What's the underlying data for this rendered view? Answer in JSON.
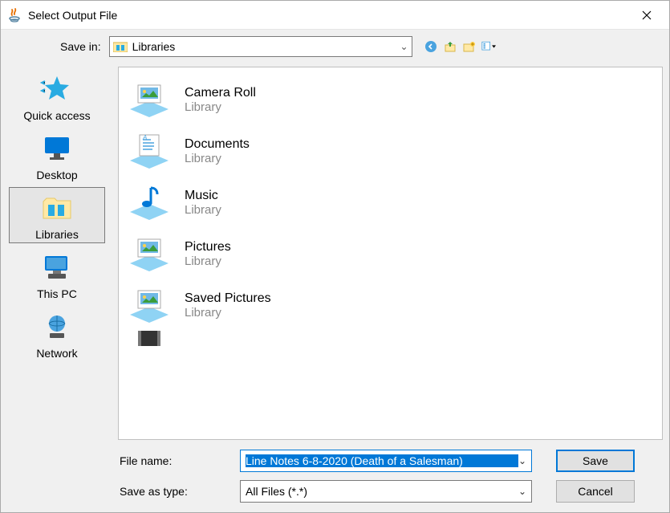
{
  "window": {
    "title": "Select Output File"
  },
  "toolbar": {
    "save_in_label": "Save in:",
    "location": "Libraries"
  },
  "sidebar": {
    "items": [
      {
        "label": "Quick access"
      },
      {
        "label": "Desktop"
      },
      {
        "label": "Libraries"
      },
      {
        "label": "This PC"
      },
      {
        "label": "Network"
      }
    ]
  },
  "files": [
    {
      "name": "Camera Roll",
      "subtitle": "Library",
      "icon": "image"
    },
    {
      "name": "Documents",
      "subtitle": "Library",
      "icon": "doc"
    },
    {
      "name": "Music",
      "subtitle": "Library",
      "icon": "music"
    },
    {
      "name": "Pictures",
      "subtitle": "Library",
      "icon": "image"
    },
    {
      "name": "Saved Pictures",
      "subtitle": "Library",
      "icon": "image"
    }
  ],
  "form": {
    "filename_label": "File name:",
    "filename_value": "Line Notes 6-8-2020 (Death of a Salesman)",
    "type_label": "Save as type:",
    "type_value": "All Files (*.*)",
    "save_button": "Save",
    "cancel_button": "Cancel"
  }
}
